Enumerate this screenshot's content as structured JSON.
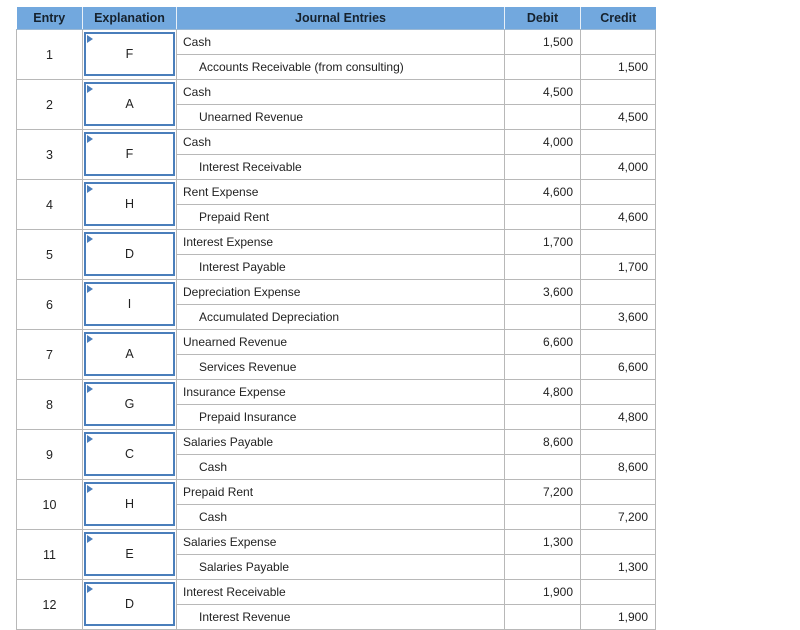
{
  "table": {
    "columns": [
      {
        "key": "entry",
        "label": "Entry"
      },
      {
        "key": "explanation",
        "label": "Explanation"
      },
      {
        "key": "journal",
        "label": "Journal Entries"
      },
      {
        "key": "debit",
        "label": "Debit"
      },
      {
        "key": "credit",
        "label": "Credit"
      }
    ],
    "colors": {
      "header_background": "#72a8de",
      "header_text": "#16222e",
      "cell_border": "#b8b8b8",
      "select_border": "#4a7ebb",
      "select_marker": "#4a7ebb",
      "cell_text": "#222222"
    },
    "select_marker_icon": "caret-right-icon",
    "rows": [
      {
        "entry": "1",
        "explanation": "F",
        "lines": [
          {
            "account": "Cash",
            "indent": false,
            "debit": "1,500",
            "credit": ""
          },
          {
            "account": "Accounts Receivable (from consulting)",
            "indent": true,
            "debit": "",
            "credit": "1,500"
          }
        ]
      },
      {
        "entry": "2",
        "explanation": "A",
        "lines": [
          {
            "account": "Cash",
            "indent": false,
            "debit": "4,500",
            "credit": ""
          },
          {
            "account": "Unearned Revenue",
            "indent": true,
            "debit": "",
            "credit": "4,500"
          }
        ]
      },
      {
        "entry": "3",
        "explanation": "F",
        "lines": [
          {
            "account": "Cash",
            "indent": false,
            "debit": "4,000",
            "credit": ""
          },
          {
            "account": "Interest Receivable",
            "indent": true,
            "debit": "",
            "credit": "4,000"
          }
        ]
      },
      {
        "entry": "4",
        "explanation": "H",
        "lines": [
          {
            "account": "Rent Expense",
            "indent": false,
            "debit": "4,600",
            "credit": ""
          },
          {
            "account": "Prepaid Rent",
            "indent": true,
            "debit": "",
            "credit": "4,600"
          }
        ]
      },
      {
        "entry": "5",
        "explanation": "D",
        "lines": [
          {
            "account": "Interest Expense",
            "indent": false,
            "debit": "1,700",
            "credit": ""
          },
          {
            "account": "Interest Payable",
            "indent": true,
            "debit": "",
            "credit": "1,700"
          }
        ]
      },
      {
        "entry": "6",
        "explanation": "I",
        "lines": [
          {
            "account": "Depreciation Expense",
            "indent": false,
            "debit": "3,600",
            "credit": ""
          },
          {
            "account": "Accumulated Depreciation",
            "indent": true,
            "debit": "",
            "credit": "3,600"
          }
        ]
      },
      {
        "entry": "7",
        "explanation": "A",
        "lines": [
          {
            "account": "Unearned Revenue",
            "indent": false,
            "debit": "6,600",
            "credit": ""
          },
          {
            "account": "Services Revenue",
            "indent": true,
            "debit": "",
            "credit": "6,600"
          }
        ]
      },
      {
        "entry": "8",
        "explanation": "G",
        "lines": [
          {
            "account": "Insurance Expense",
            "indent": false,
            "debit": "4,800",
            "credit": ""
          },
          {
            "account": "Prepaid Insurance",
            "indent": true,
            "debit": "",
            "credit": "4,800"
          }
        ]
      },
      {
        "entry": "9",
        "explanation": "C",
        "lines": [
          {
            "account": "Salaries Payable",
            "indent": false,
            "debit": "8,600",
            "credit": ""
          },
          {
            "account": "Cash",
            "indent": true,
            "debit": "",
            "credit": "8,600"
          }
        ]
      },
      {
        "entry": "10",
        "explanation": "H",
        "lines": [
          {
            "account": "Prepaid Rent",
            "indent": false,
            "debit": "7,200",
            "credit": ""
          },
          {
            "account": "Cash",
            "indent": true,
            "debit": "",
            "credit": "7,200"
          }
        ]
      },
      {
        "entry": "11",
        "explanation": "E",
        "lines": [
          {
            "account": "Salaries Expense",
            "indent": false,
            "debit": "1,300",
            "credit": ""
          },
          {
            "account": "Salaries Payable",
            "indent": true,
            "debit": "",
            "credit": "1,300"
          }
        ]
      },
      {
        "entry": "12",
        "explanation": "D",
        "lines": [
          {
            "account": "Interest Receivable",
            "indent": false,
            "debit": "1,900",
            "credit": ""
          },
          {
            "account": "Interest Revenue",
            "indent": true,
            "debit": "",
            "credit": "1,900"
          }
        ]
      }
    ]
  }
}
